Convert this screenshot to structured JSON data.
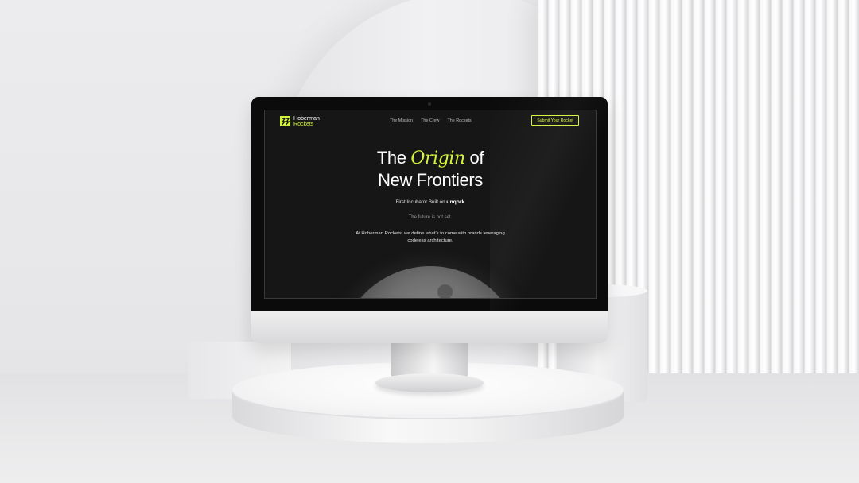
{
  "site": {
    "logo": {
      "line1": "Hoberman",
      "line2": "Rockets"
    },
    "nav": [
      {
        "label": "The Mission"
      },
      {
        "label": "The Crew"
      },
      {
        "label": "The Rockets"
      }
    ],
    "cta_label": "Submit Your Rocket",
    "hero": {
      "title_before": "The",
      "title_accent": "Origin",
      "title_after": "of",
      "title_line2": "New Frontiers",
      "subline_text": "First Incubator Built on",
      "subline_brand": "unqork",
      "tagline": "The future is not set.",
      "description": "At Hoberman Rockets, we define what’s to come with brands leveraging codeless architecture."
    }
  },
  "colors": {
    "accent": "#d4f43c",
    "site_background": "#161616",
    "text": "#ffffff"
  },
  "icons": {
    "logo_mark": "hoberman-logo-icon"
  }
}
